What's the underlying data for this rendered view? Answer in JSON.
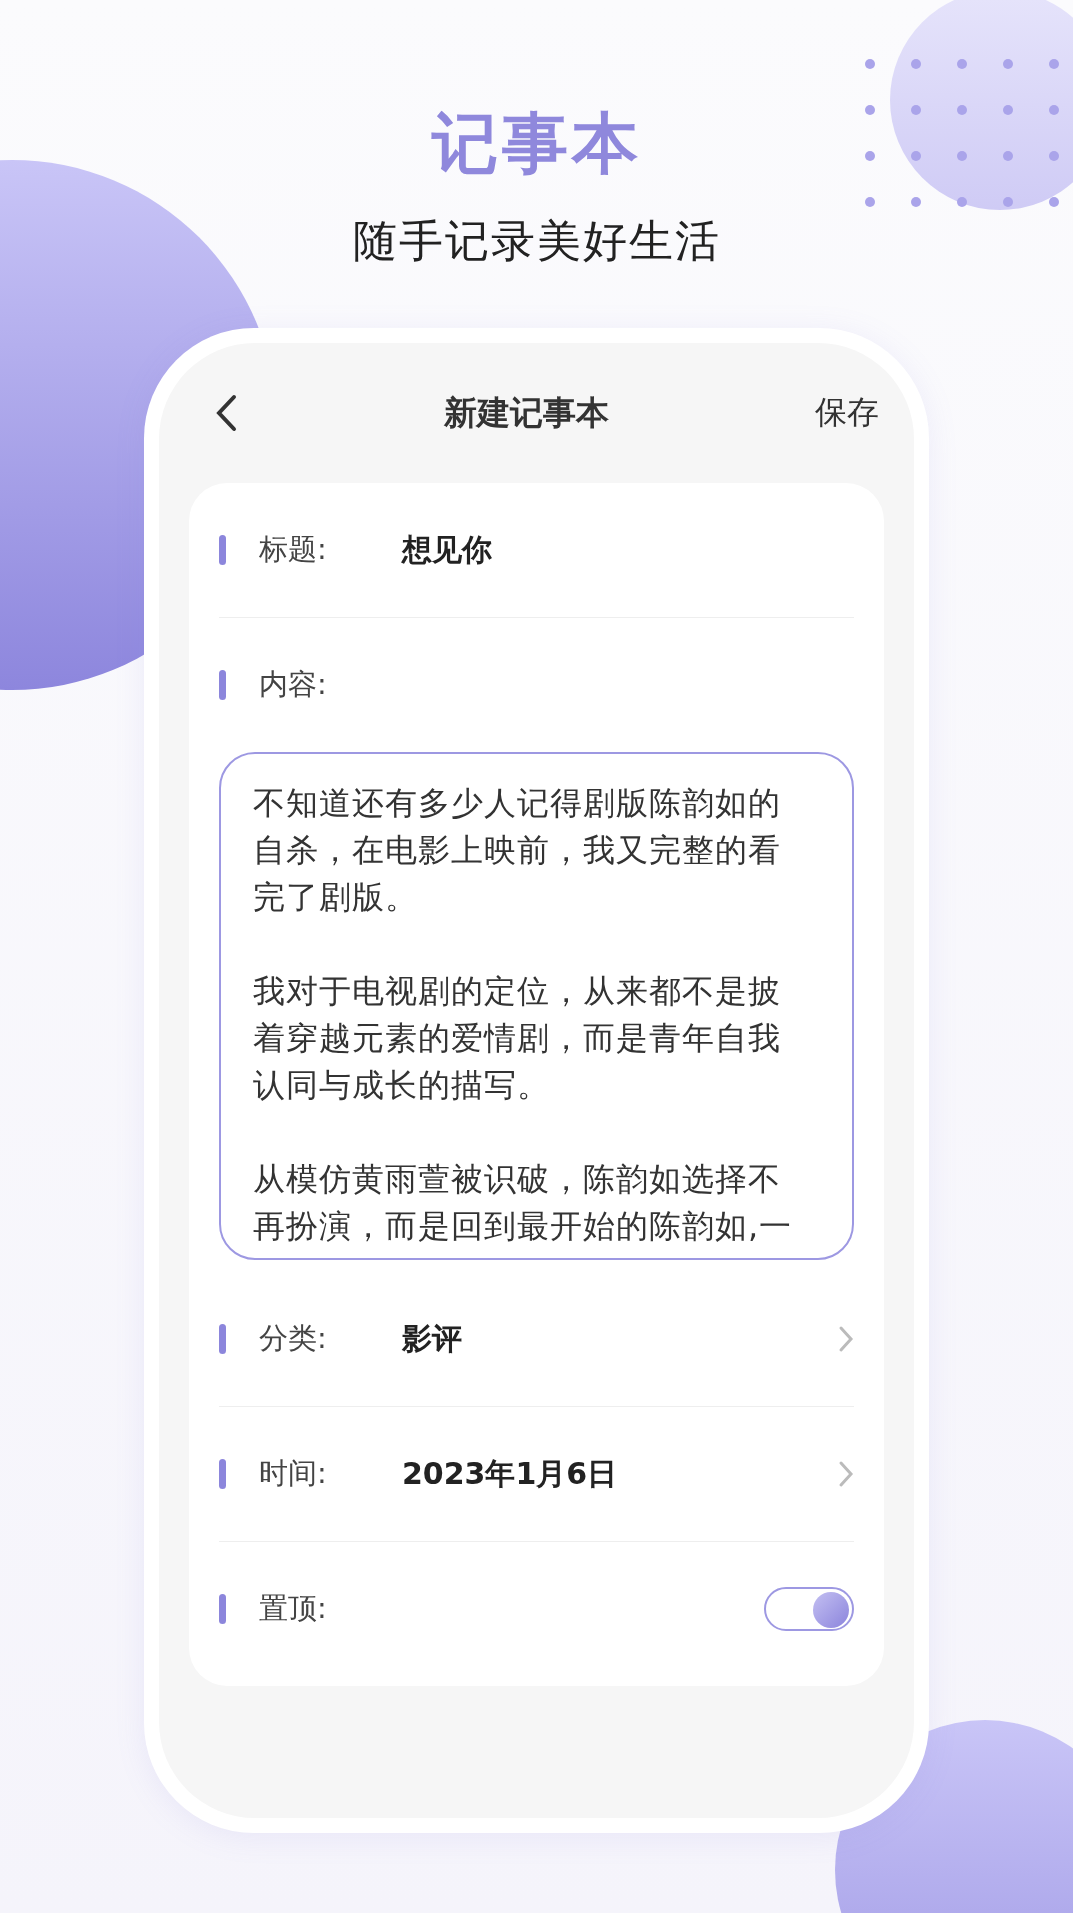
{
  "banner": {
    "title": "记事本",
    "subtitle": "随手记录美好生活"
  },
  "header": {
    "title": "新建记事本",
    "action": "保存"
  },
  "form": {
    "title_row": {
      "label": "标题:",
      "value": "想见你"
    },
    "content": {
      "label": "内容:",
      "paragraphs": [
        "不知道还有多少人记得剧版陈韵如的自杀，在电影上映前，我又完整的看完了剧版。",
        "我对于电视剧的定位，从来都不是披着穿越元素的爱情剧，而是青年自我认同与成长的描写。",
        "从模仿黄雨萱被识破，陈韵如选择不再扮演，而是回到最开始的陈韵如,一"
      ]
    },
    "rows": [
      {
        "kind": "select",
        "label": "分类:",
        "value": "影评"
      },
      {
        "kind": "select",
        "label": "时间:",
        "value": "2023年1月6日"
      },
      {
        "kind": "toggle",
        "label": "置顶:",
        "on": true
      }
    ]
  }
}
